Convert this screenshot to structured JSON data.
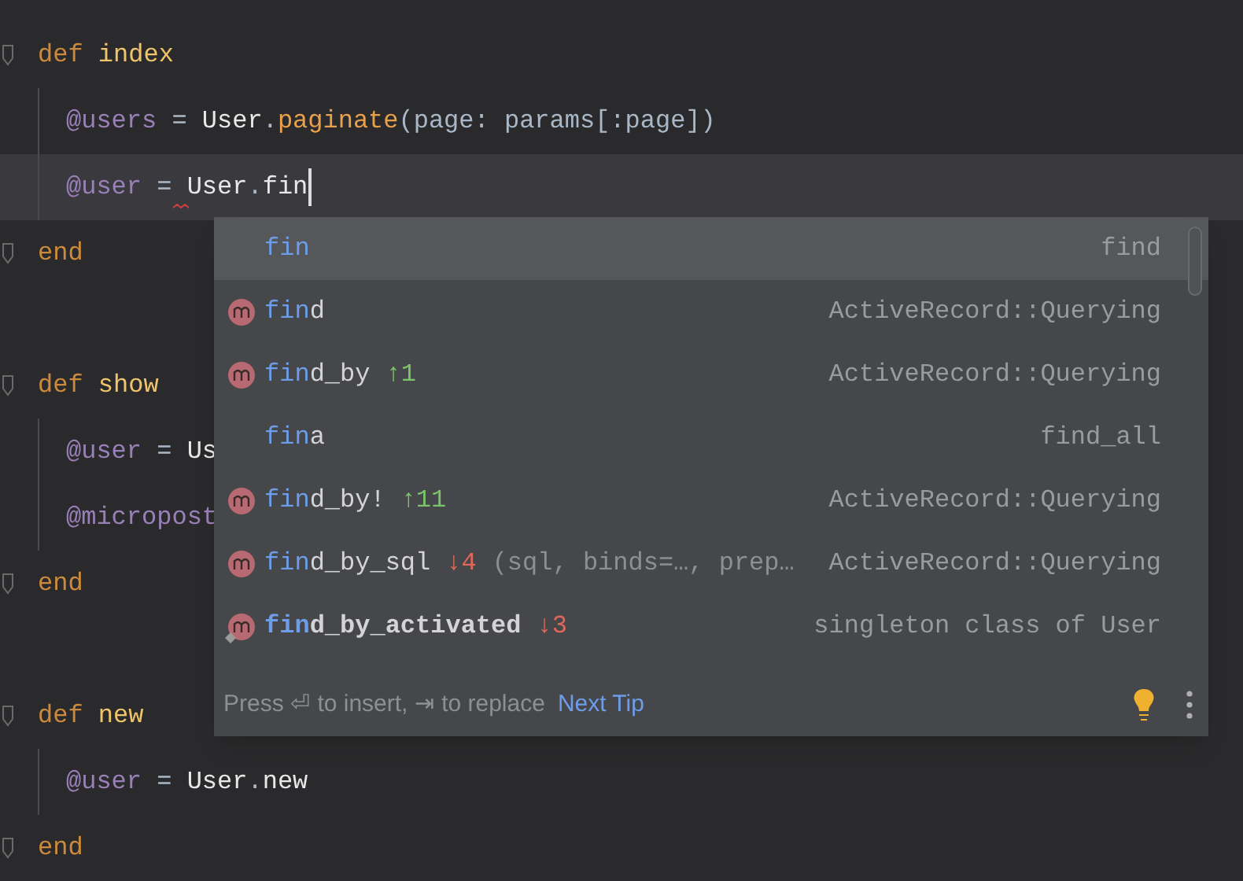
{
  "editor": {
    "lines": [
      {
        "fold": true,
        "indented": false,
        "current": false,
        "tokens": [
          {
            "text": "def",
            "kind": "keyword"
          },
          {
            "text": "index",
            "kind": "defname"
          }
        ]
      },
      {
        "fold": false,
        "indented": true,
        "current": false,
        "tokens": [
          {
            "text": "@users",
            "kind": "ivar"
          },
          {
            "text": " = ",
            "kind": "plain"
          },
          {
            "text": "User",
            "kind": "const"
          },
          {
            "text": ".",
            "kind": "plain"
          },
          {
            "text": "paginate",
            "kind": "call"
          },
          {
            "text": "(page: params[:page])",
            "kind": "plain"
          }
        ]
      },
      {
        "fold": false,
        "indented": true,
        "current": true,
        "caret": true,
        "squiggle": true,
        "tokens": [
          {
            "text": "@user",
            "kind": "ivar"
          },
          {
            "text": " = ",
            "kind": "plain"
          },
          {
            "text": "User",
            "kind": "const"
          },
          {
            "text": ".",
            "kind": "plain"
          },
          {
            "text": "fin",
            "kind": "const"
          }
        ]
      },
      {
        "fold": true,
        "indented": false,
        "current": false,
        "tokens": [
          {
            "text": "end",
            "kind": "keyword"
          }
        ]
      },
      {
        "fold": false,
        "indented": false,
        "current": false
      },
      {
        "fold": true,
        "indented": false,
        "current": false,
        "tokens": [
          {
            "text": "def",
            "kind": "keyword"
          },
          {
            "text": "show",
            "kind": "defname"
          }
        ]
      },
      {
        "fold": false,
        "indented": true,
        "current": false,
        "tokens": [
          {
            "text": "@user",
            "kind": "ivar"
          },
          {
            "text": " = ",
            "kind": "plain"
          },
          {
            "text": "Us",
            "kind": "const"
          }
        ]
      },
      {
        "fold": false,
        "indented": true,
        "current": false,
        "tokens": [
          {
            "text": "@micropost",
            "kind": "ivar"
          }
        ]
      },
      {
        "fold": true,
        "indented": false,
        "current": false,
        "tokens": [
          {
            "text": "end",
            "kind": "keyword"
          }
        ]
      },
      {
        "fold": false,
        "indented": false,
        "current": false
      },
      {
        "fold": true,
        "indented": false,
        "current": false,
        "tokens": [
          {
            "text": "def",
            "kind": "keyword"
          },
          {
            "text": "new",
            "kind": "defname"
          }
        ]
      },
      {
        "fold": false,
        "indented": true,
        "current": false,
        "tokens": [
          {
            "text": "@user",
            "kind": "ivar"
          },
          {
            "text": " = ",
            "kind": "plain"
          },
          {
            "text": "User",
            "kind": "const"
          },
          {
            "text": ".",
            "kind": "plain"
          },
          {
            "text": "new",
            "kind": "const"
          }
        ]
      },
      {
        "fold": true,
        "indented": false,
        "current": false,
        "tokens": [
          {
            "text": "end",
            "kind": "keyword"
          }
        ]
      }
    ]
  },
  "completion": {
    "items": [
      {
        "kind": "template",
        "selected": true,
        "match": "fin",
        "bold": false,
        "pinned": false,
        "type": "find"
      },
      {
        "kind": "method",
        "selected": false,
        "match": "fin",
        "rest": "d",
        "bold": false,
        "pinned": false,
        "type": "ActiveRecord::Querying"
      },
      {
        "kind": "method",
        "selected": false,
        "match": "fin",
        "rest": "d_by",
        "bold": false,
        "pinned": false,
        "delta": {
          "text": "↑1",
          "color": "#7cc46a"
        },
        "type": "ActiveRecord::Querying"
      },
      {
        "kind": "template",
        "selected": false,
        "match": "fin",
        "rest": "a",
        "bold": false,
        "pinned": false,
        "type": "find_all"
      },
      {
        "kind": "method",
        "selected": false,
        "match": "fin",
        "rest": "d_by!",
        "bold": false,
        "pinned": false,
        "delta": {
          "text": "↑11",
          "color": "#7cc46a"
        },
        "type": "ActiveRecord::Querying"
      },
      {
        "kind": "method",
        "selected": false,
        "match": "fin",
        "rest": "d_by_sql",
        "bold": false,
        "pinned": false,
        "delta": {
          "text": "↓4",
          "color": "#e0685a"
        },
        "params": "(sql, binds=…, prep…",
        "type": "ActiveRecord::Querying"
      },
      {
        "kind": "method",
        "selected": false,
        "pinned": true,
        "match": "fin",
        "rest": "d_by_activated",
        "bold": true,
        "delta": {
          "text": "↓3",
          "color": "#e0685a"
        },
        "type": "singleton class of User"
      }
    ],
    "hint_press": "Press",
    "hint_enter": "⏎",
    "hint_insert": "to insert,",
    "hint_tab": "⇥",
    "hint_replace": "to replace",
    "next_tip": "Next Tip"
  }
}
